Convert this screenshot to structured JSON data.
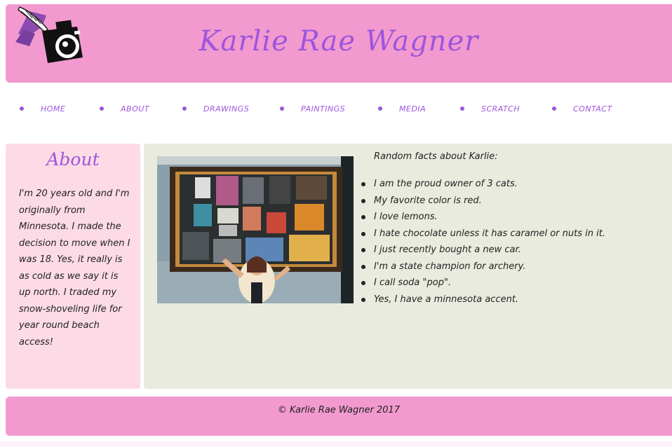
{
  "header": {
    "title": "Karlie Rae Wagner",
    "logo_icon": "camera-feather-logo-icon"
  },
  "nav": {
    "items": [
      {
        "label": "HOME"
      },
      {
        "label": "ABOUT"
      },
      {
        "label": "DRAWINGS"
      },
      {
        "label": "PAINTINGS"
      },
      {
        "label": "MEDIA"
      },
      {
        "label": "SCRATCH"
      },
      {
        "label": "CONTACT"
      }
    ]
  },
  "sidebar": {
    "title": "About",
    "text": "I'm 20 years old and I'm originally from Minnesota. I made the decision to move when I was 18. Yes, it really is as cold as we say it is up north. I traded my snow-shoveling life for year round beach access!"
  },
  "content": {
    "facts_heading": "Random facts about Karlie:",
    "facts": [
      "I am the proud owner of 3 cats.",
      "My favorite color is red.",
      "I love lemons.",
      "I hate chocolate unless it has caramel or nuts in it.",
      "I just recently bought a new car.",
      "I'm a state champion for archery.",
      "I call soda \"pop\".",
      "Yes, I have a minnesota accent."
    ]
  },
  "footer": {
    "text": "© Karlie Rae Wagner 2017"
  },
  "colors": {
    "header_pink": "#f29acf",
    "accent_purple": "#9d55dd",
    "sidebar_pink": "#fcdbe6",
    "content_beige": "#e9ebdf"
  }
}
